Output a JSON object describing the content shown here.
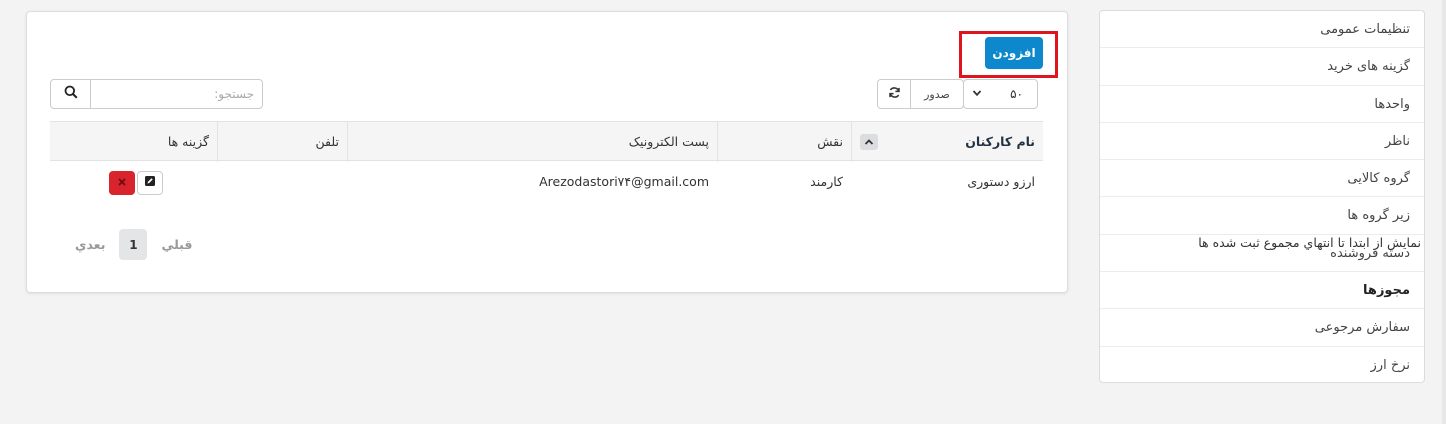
{
  "sidebar": {
    "items": [
      {
        "label": "تنظیمات عمومی"
      },
      {
        "label": "گزینه های خرید"
      },
      {
        "label": "واحدها"
      },
      {
        "label": "ناظر"
      },
      {
        "label": "گروه کالایی"
      },
      {
        "label": "زیر گروه ها"
      },
      {
        "label": "دسته فروشنده"
      },
      {
        "label": "مجوزها",
        "active": true
      },
      {
        "label": "سفارش مرجوعی"
      },
      {
        "label": "نرخ ارز"
      }
    ]
  },
  "toolbar": {
    "add_label": "افزودن",
    "page_size": "۵۰",
    "export_label": "صدور",
    "search_placeholder": "جستجو:"
  },
  "table": {
    "headers": {
      "name": "نام کارکنان",
      "role": "نقش",
      "email": "پست الکترونیک",
      "phone": "تلفن",
      "options": "گزینه ها"
    },
    "rows": [
      {
        "name": "ارزو دستوری",
        "role": "کارمند",
        "email": "Arezodastori۷۴@gmail.com",
        "phone": ""
      }
    ]
  },
  "footer": {
    "info": "نمايش از ابتدا تا انتهاي مجموع ثبت شده ها",
    "prev": "قبلي",
    "page": "1",
    "next": "بعدي"
  },
  "colors": {
    "primary": "#0d88cc",
    "danger": "#d9232d",
    "highlight": "#e0141e"
  }
}
